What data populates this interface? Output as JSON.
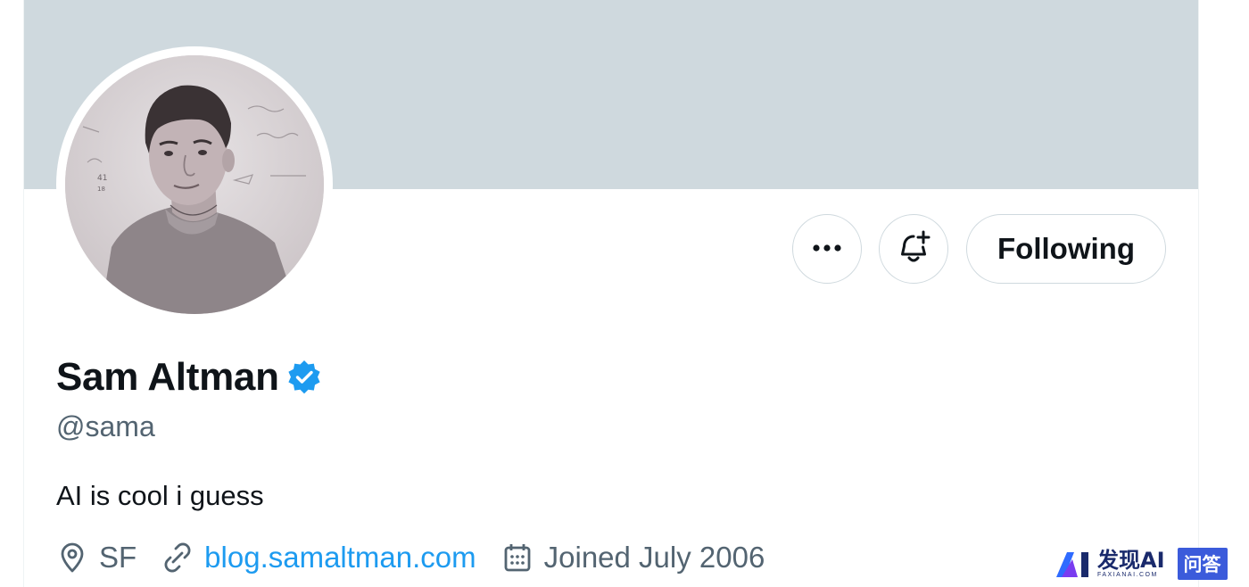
{
  "profile": {
    "display_name": "Sam Altman",
    "handle": "@sama",
    "bio": "AI is cool i guess",
    "location": "SF",
    "website": "blog.samaltman.com",
    "joined": "Joined July 2006",
    "verified": true
  },
  "actions": {
    "more_icon": "more-horizontal-icon",
    "notify_icon": "bell-plus-icon",
    "following_label": "Following"
  },
  "icons": {
    "location": "location-pin-icon",
    "website": "link-icon",
    "joined": "calendar-icon",
    "verified": "verified-badge-icon"
  },
  "colors": {
    "banner": "#cfd9de",
    "link": "#1d9bf0",
    "secondary_text": "#536471",
    "primary_text": "#0f1419",
    "verified": "#1d9bf0"
  },
  "watermark": {
    "brand": "发现AI",
    "brand_sub": "FAXIANAI.COM",
    "badge": "问答"
  }
}
